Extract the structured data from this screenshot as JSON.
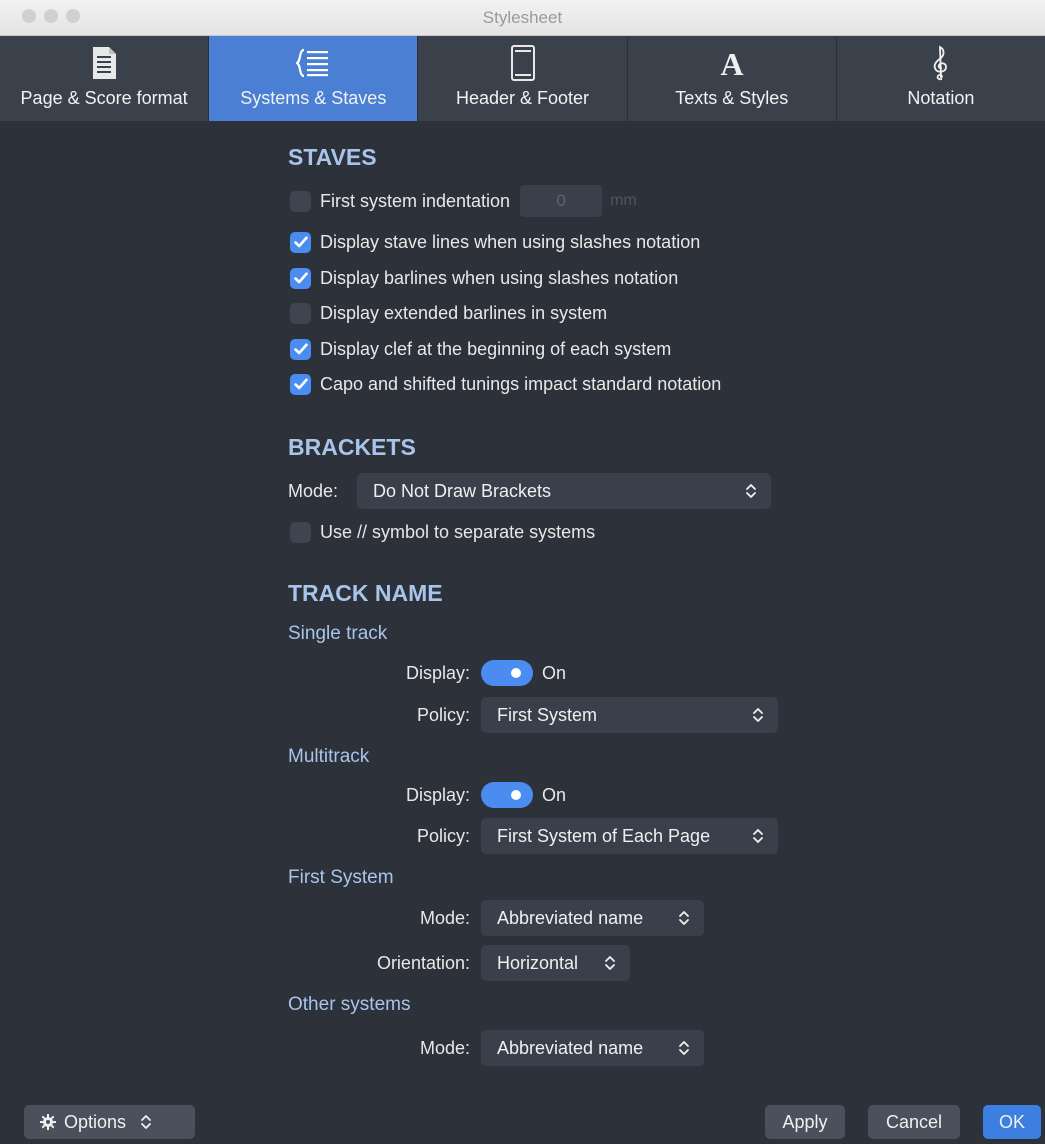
{
  "window": {
    "title": "Stylesheet"
  },
  "tabs": [
    {
      "label": "Page & Score format",
      "icon": "page-icon",
      "active": false
    },
    {
      "label": "Systems & Staves",
      "icon": "systems-icon",
      "active": true
    },
    {
      "label": "Header & Footer",
      "icon": "header-footer-icon",
      "active": false
    },
    {
      "label": "Texts & Styles",
      "icon": "text-icon",
      "active": false
    },
    {
      "label": "Notation",
      "icon": "treble-clef-icon",
      "active": false
    }
  ],
  "staves": {
    "title": "STAVES",
    "indentation": {
      "label": "First system indentation",
      "value": "0",
      "unit": "mm",
      "checked": false
    },
    "options": [
      {
        "label": "Display stave lines when using slashes notation",
        "checked": true
      },
      {
        "label": "Display barlines when using slashes notation",
        "checked": true
      },
      {
        "label": "Display extended barlines in system",
        "checked": false
      },
      {
        "label": "Display clef at the beginning of each system",
        "checked": true
      },
      {
        "label": "Capo and shifted tunings impact standard notation",
        "checked": true
      }
    ]
  },
  "brackets": {
    "title": "BRACKETS",
    "mode_label": "Mode:",
    "mode_value": "Do Not Draw Brackets",
    "separator": {
      "label": "Use // symbol to separate systems",
      "checked": false
    }
  },
  "track_name": {
    "title": "TRACK NAME",
    "single": {
      "title": "Single track",
      "display_label": "Display:",
      "display_value": "On",
      "policy_label": "Policy:",
      "policy_value": "First System"
    },
    "multi": {
      "title": "Multitrack",
      "display_label": "Display:",
      "display_value": "On",
      "policy_label": "Policy:",
      "policy_value": "First System of Each Page"
    },
    "first_system": {
      "title": "First System",
      "mode_label": "Mode:",
      "mode_value": "Abbreviated name",
      "orientation_label": "Orientation:",
      "orientation_value": "Horizontal"
    },
    "other_systems": {
      "title": "Other systems",
      "mode_label": "Mode:",
      "mode_value": "Abbreviated name"
    }
  },
  "footer": {
    "options_label": "Options",
    "apply_label": "Apply",
    "cancel_label": "Cancel",
    "ok_label": "OK"
  },
  "colors": {
    "accent": "#4a8cf0",
    "section": "#a8c4ea",
    "background": "#2d3139"
  }
}
